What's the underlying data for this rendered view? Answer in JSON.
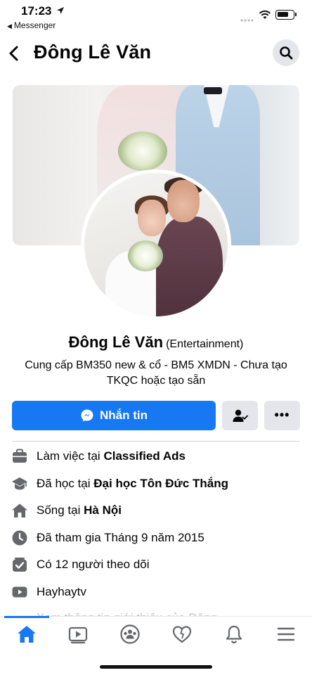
{
  "status_bar": {
    "time": "17:23",
    "back_app": "Messenger",
    "battery_level": 0.75
  },
  "header": {
    "title": "Đông Lê Văn"
  },
  "profile": {
    "name": "Đông Lê Văn",
    "category": "(Entertainment)",
    "bio": "Cung cấp BM350 new & cổ - BM5 XMDN - Chưa tạo TKQC hoặc tạo sẵn"
  },
  "actions": {
    "message_label": "Nhắn tin"
  },
  "details": [
    {
      "icon": "briefcase-icon",
      "prefix": "Làm việc tại ",
      "bold": "Classified Ads"
    },
    {
      "icon": "graduation-cap-icon",
      "prefix": "Đã học tại ",
      "bold": "Đại học Tôn Đức Thắng"
    },
    {
      "icon": "house-icon",
      "prefix": "Sống tại ",
      "bold": "Hà Nội"
    },
    {
      "icon": "clock-icon",
      "prefix": "Đã tham gia Tháng 9 năm 2015",
      "bold": ""
    },
    {
      "icon": "followers-icon",
      "prefix": "Có 12 người theo dõi",
      "bold": ""
    },
    {
      "icon": "youtube-icon",
      "prefix": "Hayhaytv",
      "bold": ""
    },
    {
      "icon": "more-icon",
      "prefix": "Xem thông tin giới thiệu của Đông",
      "bold": ""
    }
  ],
  "colors": {
    "accent": "#1877f2",
    "button_gray": "#e4e6eb",
    "icon_gray": "#65676b"
  },
  "tabbar": {
    "active": "home",
    "tabs": [
      "home-icon",
      "watch-icon",
      "groups-icon",
      "dating-icon",
      "notifications-icon",
      "menu-icon"
    ]
  }
}
